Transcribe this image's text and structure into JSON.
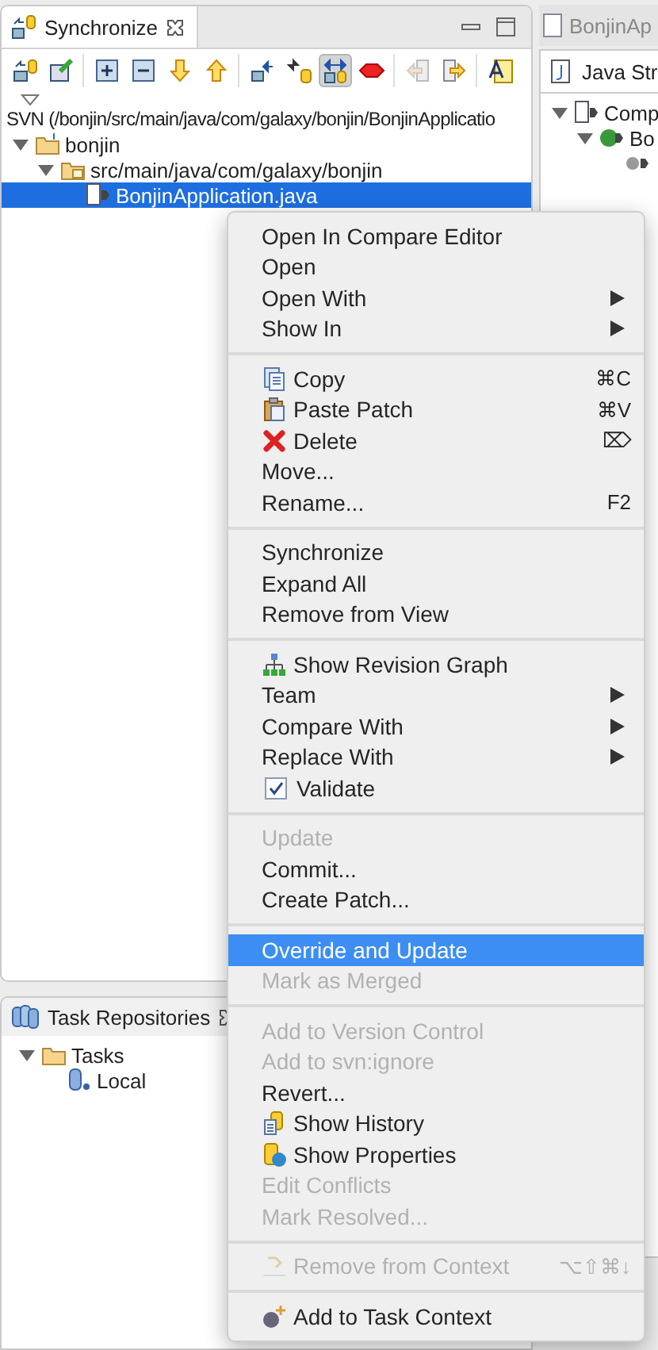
{
  "sync_view": {
    "title": "Synchronize",
    "toolbar_groups": [
      [
        {
          "pressed": false
        },
        {
          "pressed": false
        }
      ],
      [
        {
          "pressed": false
        },
        {
          "pressed": false
        },
        {
          "pressed": false
        },
        {
          "pressed": false
        }
      ],
      [
        {
          "pressed": false
        },
        {
          "pressed": false
        },
        {
          "pressed": true
        },
        {
          "pressed": false
        }
      ],
      [
        {
          "pressed": false
        },
        {
          "pressed": false
        }
      ],
      [
        {
          "pressed": false
        }
      ]
    ],
    "path": "SVN (/bonjin/src/main/java/com/galaxy/bonjin/BonjinApplicatio",
    "tree": [
      {
        "label": "bonjin",
        "expanded": true,
        "selected": false,
        "children": [
          {
            "label": "src/main/java/com/galaxy/bonjin",
            "expanded": true,
            "selected": false,
            "children": [
              {
                "label": "BonjinApplication.java",
                "selected": true
              }
            ]
          }
        ]
      }
    ]
  },
  "task_view": {
    "title": "Task Repositories",
    "tree": [
      {
        "label": "Tasks",
        "expanded": true,
        "children": [
          {
            "label": "Local"
          }
        ]
      }
    ]
  },
  "editor": {
    "tab": "BonjinAp",
    "outline_title": "Java Str",
    "tree": [
      {
        "label": "Comp",
        "expanded": true,
        "children": [
          {
            "label": "Bo",
            "expanded": true,
            "children": [
              {
                "kind": "field"
              }
            ]
          }
        ]
      }
    ]
  },
  "context_menu": [
    {
      "kind": "item",
      "label": "Open In Compare Editor",
      "disabled": false,
      "selected": false,
      "submenu": false
    },
    {
      "kind": "item",
      "label": "Open",
      "disabled": false,
      "selected": false,
      "submenu": false
    },
    {
      "kind": "item",
      "label": "Open With",
      "disabled": false,
      "selected": false,
      "submenu": true
    },
    {
      "kind": "item",
      "label": "Show In",
      "disabled": false,
      "selected": false,
      "submenu": true
    },
    {
      "kind": "separator"
    },
    {
      "kind": "item",
      "label": "Copy",
      "shortcut": "⌘C",
      "disabled": false,
      "selected": false,
      "submenu": false
    },
    {
      "kind": "item",
      "label": "Paste Patch",
      "shortcut": "⌘V",
      "disabled": false,
      "selected": false,
      "submenu": false
    },
    {
      "kind": "item",
      "label": "Delete",
      "shortcut": "⌦",
      "disabled": false,
      "selected": false,
      "submenu": false
    },
    {
      "kind": "item",
      "label": "Move...",
      "disabled": false,
      "selected": false,
      "submenu": false
    },
    {
      "kind": "item",
      "label": "Rename...",
      "shortcut": "F2",
      "disabled": false,
      "selected": false,
      "submenu": false
    },
    {
      "kind": "separator"
    },
    {
      "kind": "item",
      "label": "Synchronize",
      "disabled": false,
      "selected": false,
      "submenu": false
    },
    {
      "kind": "item",
      "label": "Expand All",
      "disabled": false,
      "selected": false,
      "submenu": false
    },
    {
      "kind": "item",
      "label": "Remove from View",
      "disabled": false,
      "selected": false,
      "submenu": false
    },
    {
      "kind": "separator"
    },
    {
      "kind": "item",
      "label": "Show Revision Graph",
      "disabled": false,
      "selected": false,
      "submenu": false
    },
    {
      "kind": "item",
      "label": "Team",
      "disabled": false,
      "selected": false,
      "submenu": true
    },
    {
      "kind": "item",
      "label": "Compare With",
      "disabled": false,
      "selected": false,
      "submenu": true
    },
    {
      "kind": "item",
      "label": "Replace With",
      "disabled": false,
      "selected": false,
      "submenu": true
    },
    {
      "kind": "check",
      "label": "Validate",
      "checked": true,
      "disabled": false,
      "selected": false,
      "submenu": false
    },
    {
      "kind": "separator"
    },
    {
      "kind": "item",
      "label": "Update",
      "disabled": true,
      "selected": false,
      "submenu": false
    },
    {
      "kind": "item",
      "label": "Commit...",
      "disabled": false,
      "selected": false,
      "submenu": false
    },
    {
      "kind": "item",
      "label": "Create Patch...",
      "disabled": false,
      "selected": false,
      "submenu": false
    },
    {
      "kind": "separator"
    },
    {
      "kind": "item",
      "label": "Override and Update",
      "disabled": false,
      "selected": true,
      "submenu": false
    },
    {
      "kind": "item",
      "label": "Mark as Merged",
      "disabled": true,
      "selected": false,
      "submenu": false
    },
    {
      "kind": "separator"
    },
    {
      "kind": "item",
      "label": "Add to Version Control",
      "disabled": true,
      "selected": false,
      "submenu": false
    },
    {
      "kind": "item",
      "label": "Add to svn:ignore",
      "disabled": true,
      "selected": false,
      "submenu": false
    },
    {
      "kind": "item",
      "label": "Revert...",
      "disabled": false,
      "selected": false,
      "submenu": false
    },
    {
      "kind": "item",
      "label": "Show History",
      "disabled": false,
      "selected": false,
      "submenu": false
    },
    {
      "kind": "item",
      "label": "Show Properties",
      "disabled": false,
      "selected": false,
      "submenu": false
    },
    {
      "kind": "item",
      "label": "Edit Conflicts",
      "disabled": true,
      "selected": false,
      "submenu": false
    },
    {
      "kind": "item",
      "label": "Mark Resolved...",
      "disabled": true,
      "selected": false,
      "submenu": false
    },
    {
      "kind": "separator"
    },
    {
      "kind": "item",
      "label": "Remove from Context",
      "shortcut": "⌥⇧⌘↓",
      "disabled": true,
      "selected": false,
      "submenu": false
    },
    {
      "kind": "separator"
    },
    {
      "kind": "item",
      "label": "Add to Task Context",
      "disabled": false,
      "selected": false,
      "submenu": false
    }
  ]
}
